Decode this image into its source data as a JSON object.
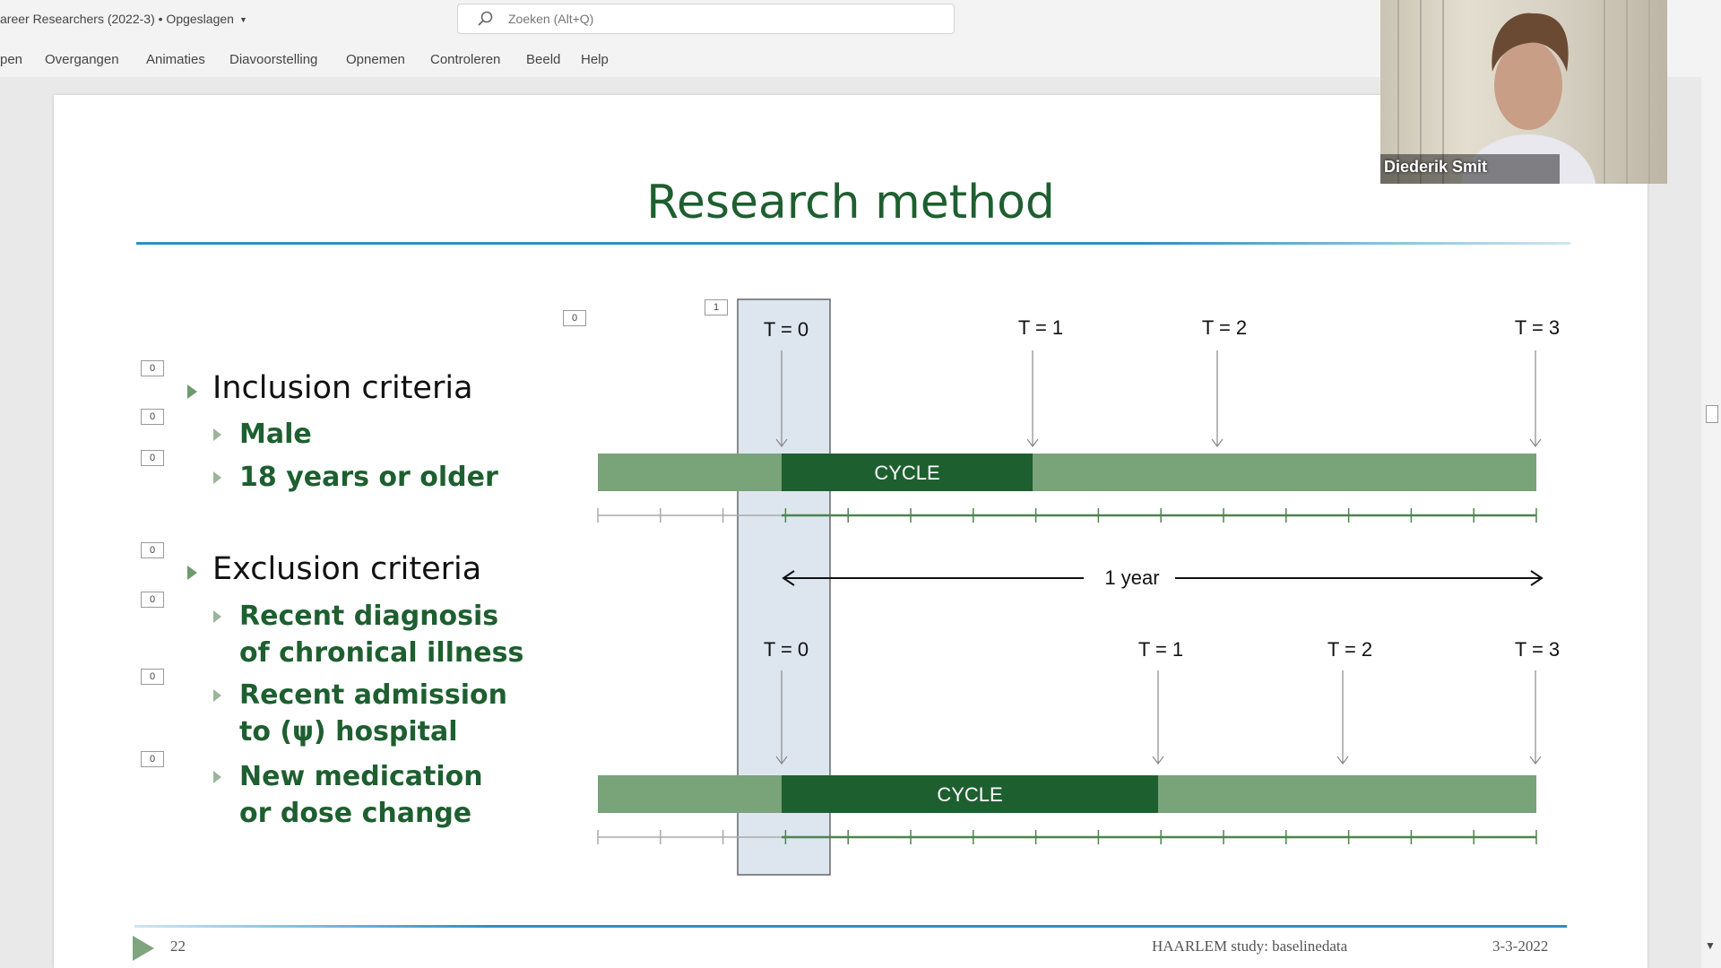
{
  "app": {
    "doc_title": "areer Researchers (2022-3) • Opgeslagen",
    "search_placeholder": "Zoeken (Alt+Q)"
  },
  "ribbon": {
    "tabs": [
      "pen",
      "Overgangen",
      "Animaties",
      "Diavoorstelling",
      "Opnemen",
      "Controleren",
      "Beeld",
      "Help"
    ]
  },
  "slide": {
    "title": "Research method",
    "animation_tags": [
      "0",
      "1",
      "0",
      "0",
      "0",
      "0",
      "0",
      "0",
      "0"
    ],
    "inclusion": {
      "heading": "Inclusion criteria",
      "items": [
        "Male",
        "18 years or older"
      ]
    },
    "exclusion": {
      "heading": "Exclusion criteria",
      "items": [
        [
          "Recent diagnosis",
          "of chronical illness"
        ],
        [
          "Recent admission",
          "to (ψ) hospital"
        ],
        [
          "New medication",
          "or dose change"
        ]
      ]
    },
    "timeline_top": {
      "labels": [
        "T = 0",
        "T = 1",
        "T = 2",
        "T = 3"
      ],
      "bar_label": "CYCLE"
    },
    "year_label": "1 year",
    "timeline_bottom": {
      "labels": [
        "T = 0",
        "T = 1",
        "T = 2",
        "T = 3"
      ],
      "bar_label": "CYCLE"
    },
    "slide_number": "22",
    "footer_study": "HAARLEM study: baselinedata",
    "footer_date": "3-3-2022"
  },
  "webcam": {
    "participant_name": "Diederik Smit"
  },
  "colors": {
    "title_green": "#1e5f30",
    "bar_light": "#79a379",
    "bar_dark": "#1e5f30",
    "highlight": "#dde6ef",
    "rule_blue": "#2e8fc0"
  }
}
